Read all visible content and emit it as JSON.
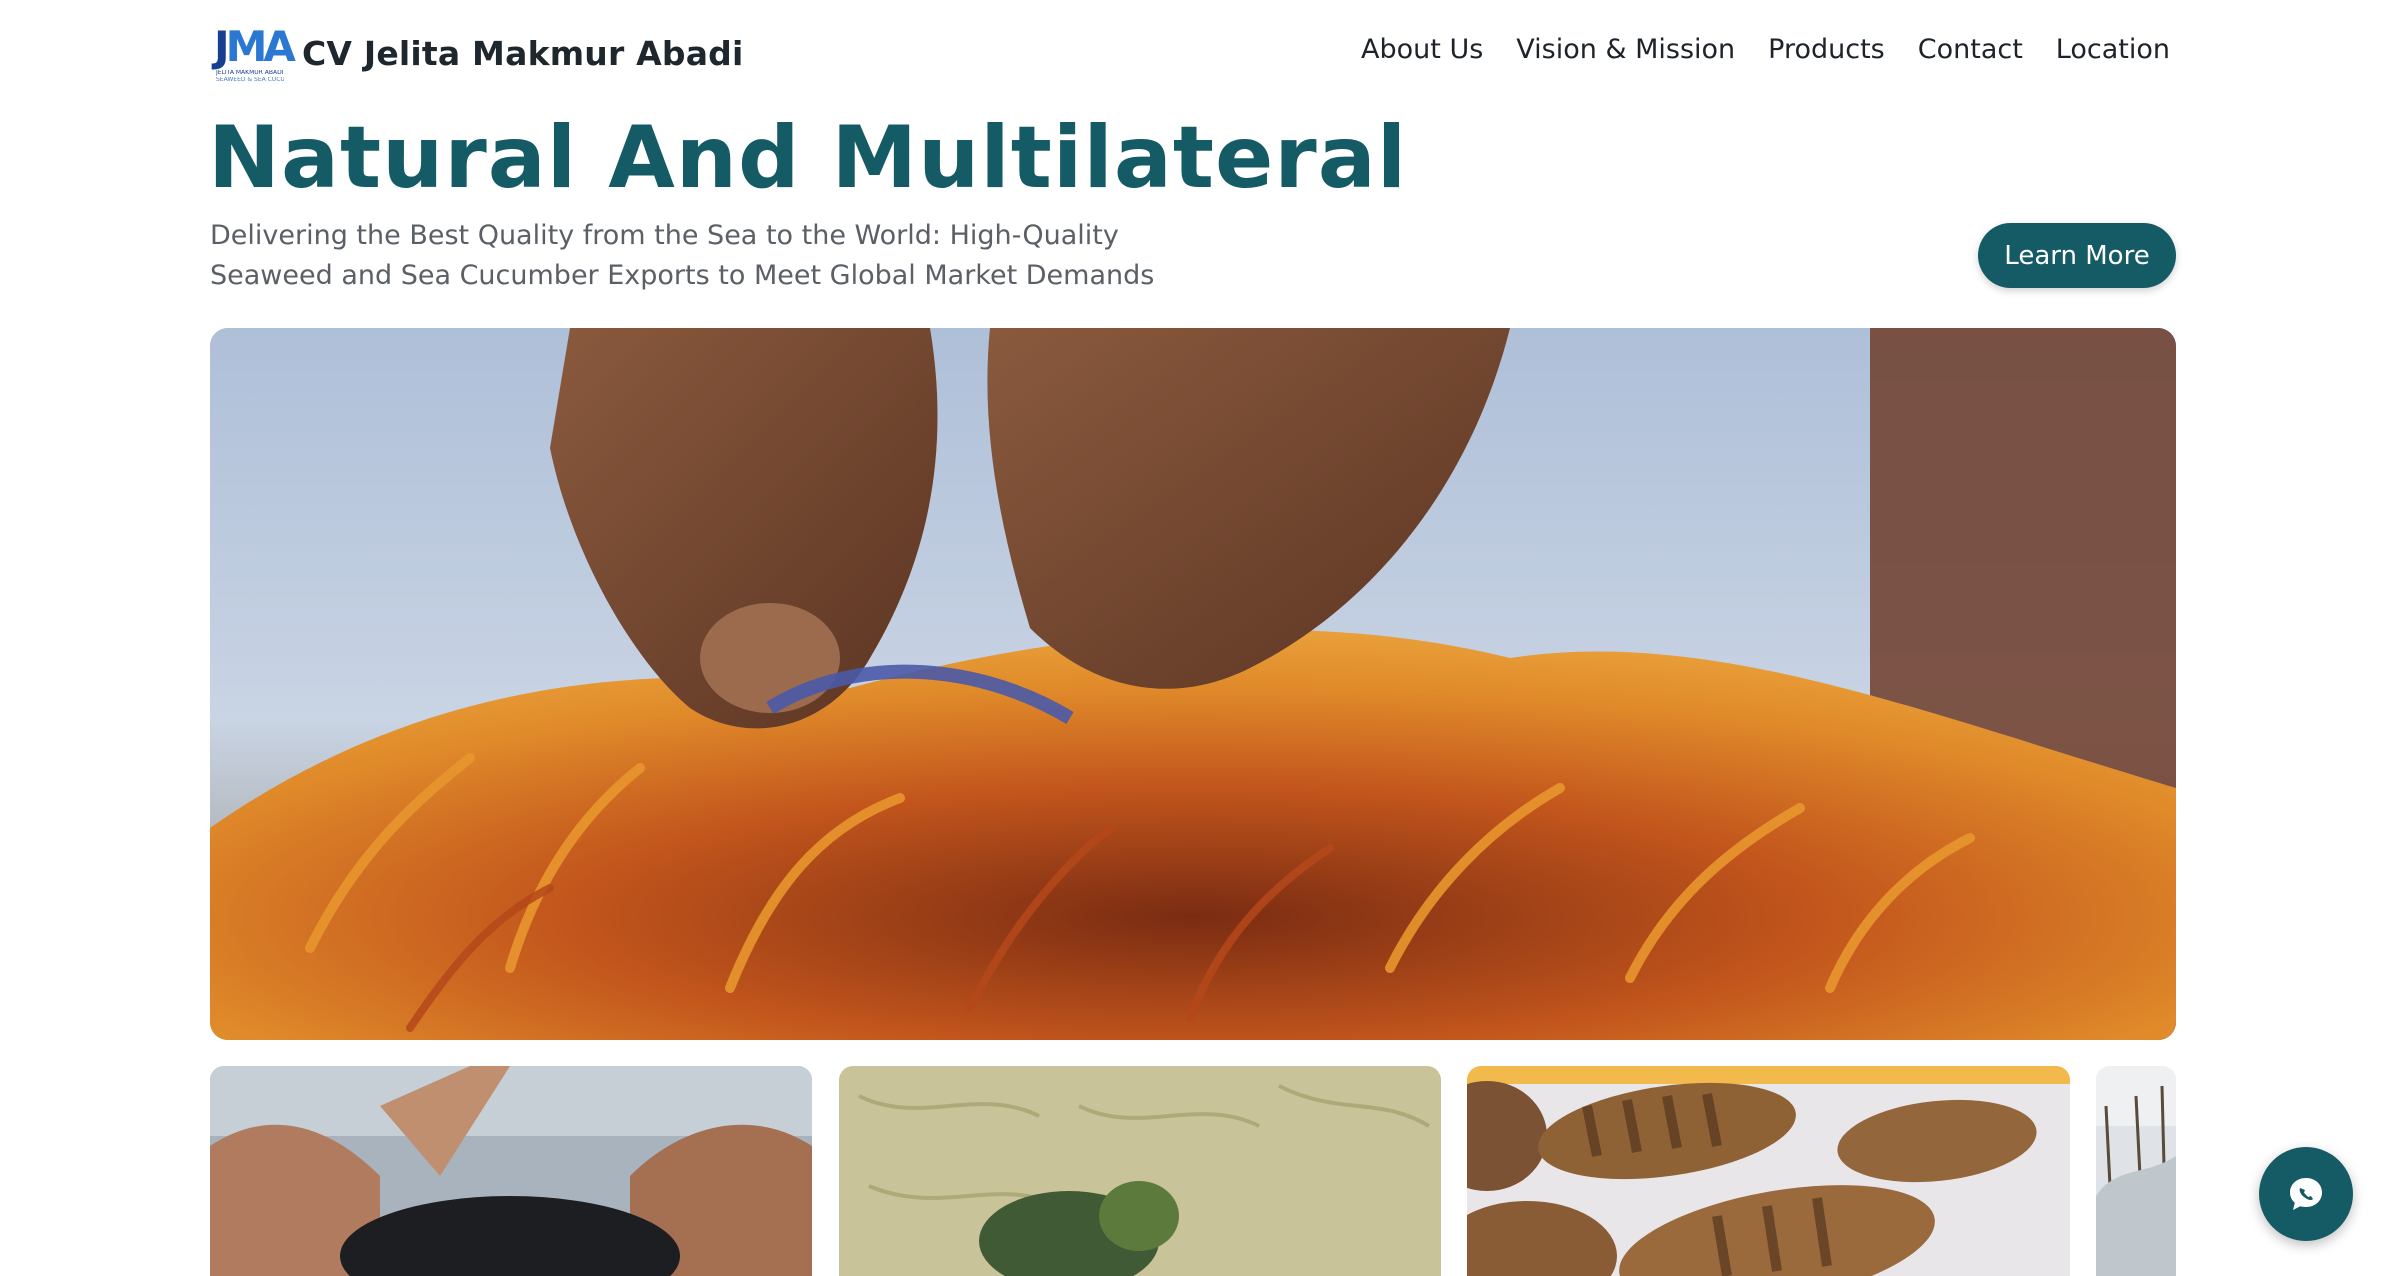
{
  "brand": {
    "logo_text": "JMA",
    "logo_tagline": "JELITA MAKMUR ABADI",
    "logo_subtagline": "SEAWEED & SEA CUCUMBER",
    "name": "CV Jelita Makmur Abadi"
  },
  "nav": {
    "items": [
      {
        "label": "About Us"
      },
      {
        "label": "Vision & Mission"
      },
      {
        "label": "Products"
      },
      {
        "label": "Contact"
      },
      {
        "label": "Location"
      }
    ]
  },
  "hero": {
    "title": "Natural And Multilateral",
    "subtitle": "Delivering the Best Quality from the Sea to the World: High-Quality Seaweed and Sea Cucumber Exports to Meet Global Market Demands",
    "cta_label": "Learn More"
  },
  "images": {
    "hero": "hands-harvesting-red-seaweed-photo",
    "thumbnails": [
      {
        "name": "hands-holding-sea-cucumber-photo"
      },
      {
        "name": "green-seaweed-photo"
      },
      {
        "name": "dried-sea-cucumbers-photo"
      },
      {
        "name": "seaweed-farm-photo"
      }
    ]
  },
  "chat": {
    "icon": "chat-bubble-icon"
  },
  "colors": {
    "primary": "#155b66",
    "text": "#1e272d",
    "muted": "#5a6066"
  }
}
